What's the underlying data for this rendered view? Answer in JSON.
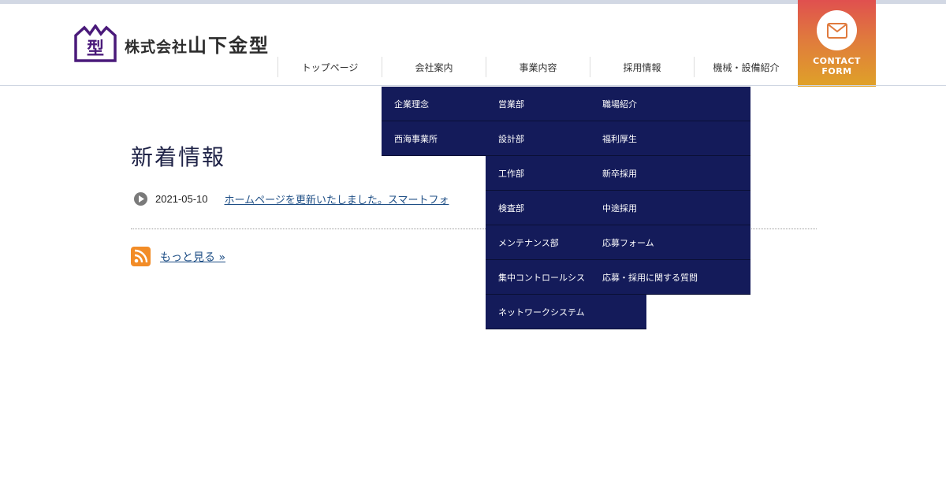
{
  "brand": {
    "logo_mark_char": "型",
    "company_prefix": "株式会社",
    "company_name": "山下金型",
    "mark_color": "#4a1a7a"
  },
  "nav": {
    "items": [
      {
        "label": "トップページ"
      },
      {
        "label": "会社案内"
      },
      {
        "label": "事業内容"
      },
      {
        "label": "採用情報"
      },
      {
        "label": "機械・設備紹介"
      }
    ]
  },
  "contact": {
    "line1": "CONTACT",
    "line2": "FORM",
    "icon": "envelope-icon"
  },
  "main": {
    "title": "新着情報",
    "news": [
      {
        "date": "2021-05-10",
        "text": "ホームページを更新いたしました。スマートフォ"
      }
    ],
    "more_label": "もっと見る »"
  },
  "dropdown": {
    "company_col": [
      "企業理念",
      "西海事業所"
    ],
    "business_col": [
      "営業部",
      "設計部",
      "工作部",
      "検査部",
      "メンテナンス部",
      "集中コントロールシス",
      "ネットワークシステム"
    ],
    "recruit_col": [
      "職場紹介",
      "福利厚生",
      "新卒採用",
      "中途採用",
      "応募フォーム",
      "応募・採用に関する質問"
    ]
  },
  "colors": {
    "menu_bg": "#141b5a",
    "title": "#1f2347",
    "link": "#1f4f86",
    "contact_gradient_top": "#e0504f",
    "contact_gradient_bottom": "#dfa228",
    "rss": "#f28c27"
  }
}
